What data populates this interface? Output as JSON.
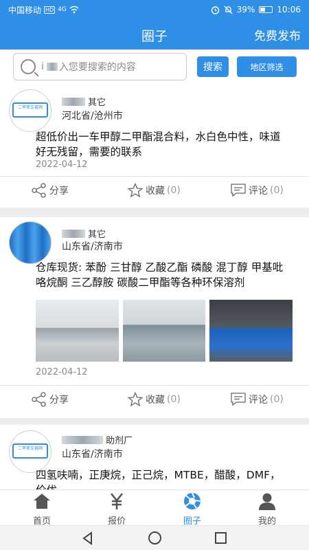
{
  "status_bar": {
    "carrier": "中国移动",
    "hd_badge": "HD",
    "signal": "4G",
    "battery_percent": "39%",
    "time": "10:06"
  },
  "header": {
    "title": "圈子",
    "publish_label": "免费发布"
  },
  "search": {
    "placeholder": "入您要搜索的内容",
    "search_label": "搜索",
    "region_label": "地区筛选"
  },
  "posts": [
    {
      "user_tag": "其它",
      "avatar_text": "二甲苯交易网",
      "location": "河北省/沧州市",
      "content": "超低价出一车甲醇二甲酯混合料，水白色中性，味道好无残留，需要的联系",
      "date": "2022-04-12",
      "share_label": "分享",
      "collect_label": "收藏",
      "collect_count": "(0)",
      "comment_label": "评论",
      "comment_count": "(0)"
    },
    {
      "user_tag": "其它",
      "location": "山东省/济南市",
      "content": "仓库现货: 苯酚 三甘醇 乙酸乙酯 磷酸 混丁醇 甲基吡咯烷酮 三乙醇胺 碳酸二甲酯等各种环保溶剂",
      "date": "2022-04-12",
      "share_label": "分享",
      "collect_label": "收藏",
      "collect_count": "(0)",
      "comment_label": "评论",
      "comment_count": "(0)"
    },
    {
      "user_tag": "助剂厂",
      "avatar_text": "二甲苯交易网",
      "location": "山东省/济南市",
      "content": "四氢呋喃，正庚烷，正己烷，MTBE，醋酸，DMF，价优"
    }
  ],
  "tabs": [
    {
      "label": "首页",
      "icon": "home-icon"
    },
    {
      "label": "报价",
      "icon": "yen-icon"
    },
    {
      "label": "圈子",
      "icon": "aperture-icon"
    },
    {
      "label": "我的",
      "icon": "user-icon"
    }
  ],
  "colors": {
    "accent": "#2f8fe6",
    "background": "#ededed"
  }
}
